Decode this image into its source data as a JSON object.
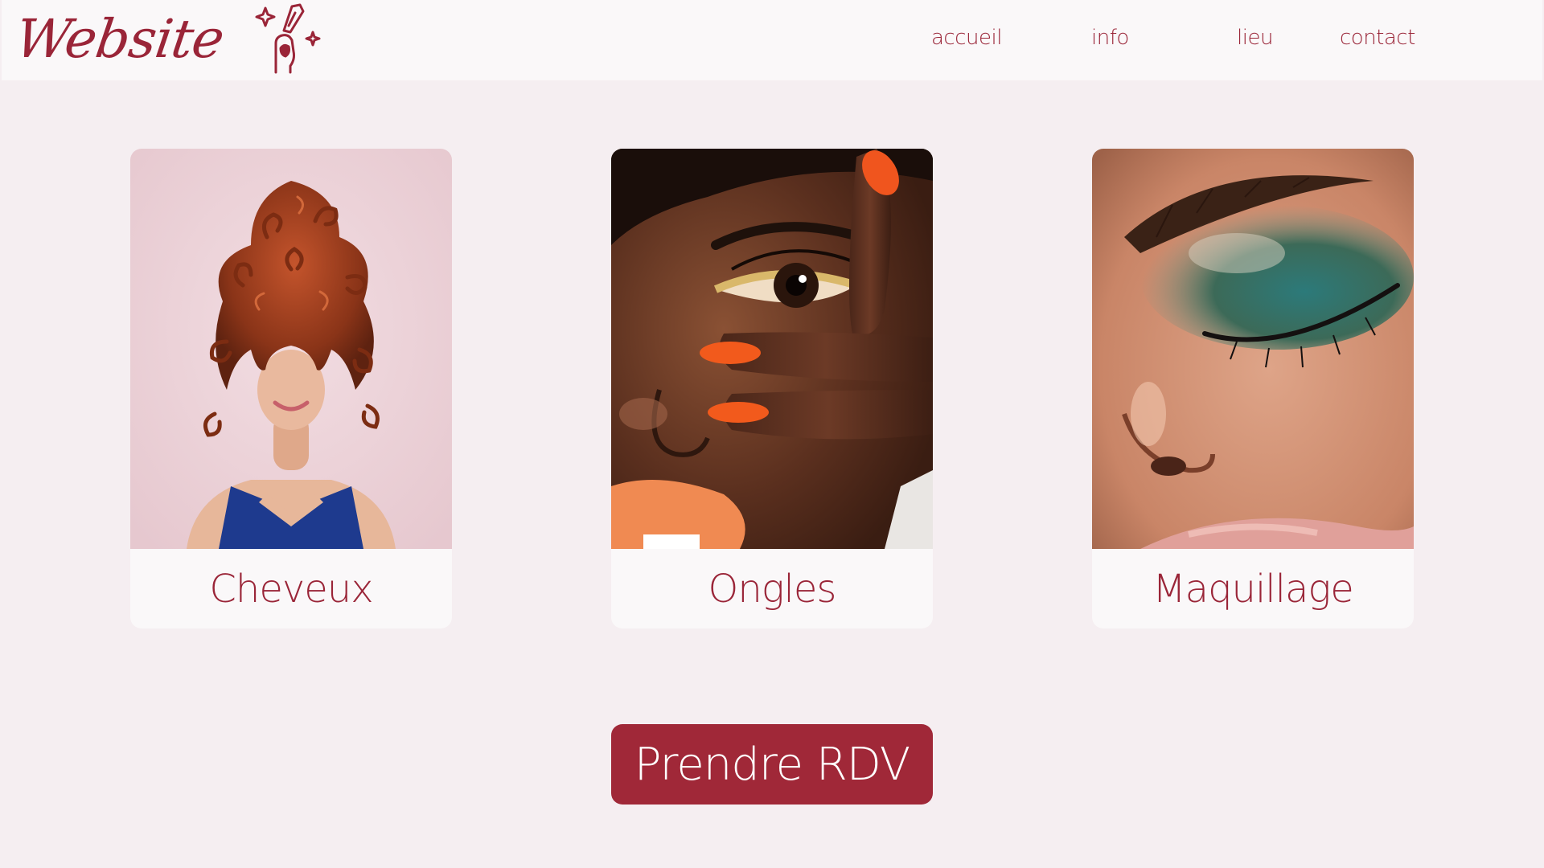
{
  "brand": {
    "logo_text": "Website",
    "logo_icon": "nail-polish-brush-sparkle-icon"
  },
  "nav": {
    "items": [
      {
        "label": "accueil"
      },
      {
        "label": "info"
      },
      {
        "label": "lieu"
      },
      {
        "label": "contact"
      }
    ]
  },
  "services": [
    {
      "label": "Cheveux",
      "image": "curly-red-hair-woman-photo"
    },
    {
      "label": "Ongles",
      "image": "orange-nails-face-closeup-photo"
    },
    {
      "label": "Maquillage",
      "image": "teal-eyeshadow-closeup-photo"
    }
  ],
  "cta": {
    "label": "Prendre RDV"
  },
  "colors": {
    "brand": "#9a2538",
    "button": "#a02838",
    "background": "#f5eef1",
    "header": "#faf8f9"
  }
}
